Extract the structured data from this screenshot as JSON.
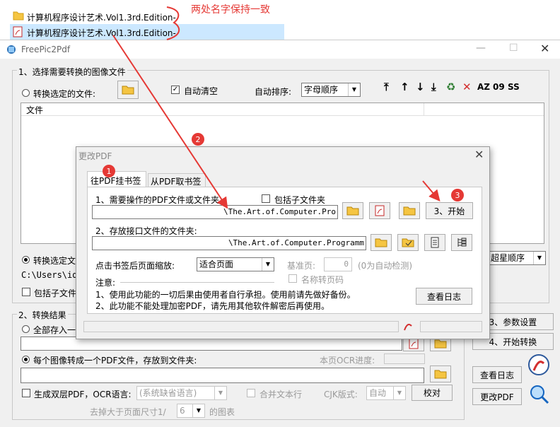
{
  "explorer": {
    "files": [
      {
        "name": "计算机程序设计艺术.Vol1.3rd.Edition-",
        "icon": "folder-icon"
      },
      {
        "name": "计算机程序设计艺术.Vol1.3rd.Edition-",
        "icon": "pdf-file-icon"
      }
    ],
    "annotation": "两处名字保持一致"
  },
  "main": {
    "title": "FreePic2Pdf",
    "group1_title": "1、选择需要转换的图像文件",
    "convert_selected_files": "转换选定的文件:",
    "auto_clear": "自动清空",
    "auto_sort_label": "自动排序:",
    "auto_sort_value": "字母顺序",
    "file_column": "文件",
    "convert_selected_partial": "转换选定文",
    "path_partial": "C:\\Users\\id",
    "include_sub_partial": "包括子文件",
    "sort_right_value": "超星顺序",
    "group2_title": "2、转换结果",
    "all_to_partial": "全部存入一",
    "each_image_pdf": "每个图像转成一个PDF文件，存放到文件夹:",
    "ocr_progress": "本页OCR进度:",
    "dual_layer": "生成双层PDF，OCR语言:",
    "ocr_lang": "(系统缺省语言)",
    "merge_text_lines": "合并文本行",
    "cjk_label": "CJK版式:",
    "cjk_value": "自动",
    "proofread": "校对",
    "remove_prefix": "去掉大于页面尺寸1/",
    "remove_value": "6",
    "remove_suffix": "的图表",
    "btn_params": "3、参数设置",
    "btn_start": "4、开始转换",
    "btn_log": "查看日志",
    "btn_modify": "更改PDF"
  },
  "dialog": {
    "title": "更改PDF",
    "tabs": [
      "往PDF挂书签",
      "从PDF取书签"
    ],
    "step1": "1、需要操作的PDF文件或文件夹",
    "include_sub": "包括子文件夹",
    "pdf_path": "\\The.Art.of.Computer.Pro",
    "start_button": "3、开始",
    "step2": "2、存放接口文件的文件夹:",
    "iface_path": "\\The.Art.of.Computer.Programm",
    "zoom_label": "点击书签后页面缩放:",
    "zoom_value": "适合页面",
    "base_page_label": "基准页:",
    "base_page_value": "0",
    "auto_detect": "(0为自动检测)",
    "name_page_no": "名称转页码",
    "notes_title": "注意:",
    "note1": "1、使用此功能的一切后果由使用者自行承担。使用前请先做好备份。",
    "note2": "2、此功能不能处理加密PDF，请先用其他软件解密后再使用。",
    "view_log": "查看日志"
  },
  "markers": [
    "1",
    "2",
    "3"
  ],
  "colors": {
    "annotation": "#e53935",
    "dialog_bg": "#f0f0f0",
    "selection": "#cce8ff"
  }
}
